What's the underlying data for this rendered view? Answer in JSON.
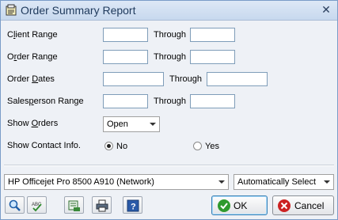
{
  "window": {
    "title": "Order Summary Report"
  },
  "form": {
    "client_range_label_pre": "C",
    "client_range_label_ul": "l",
    "client_range_label_post": "ient Range",
    "order_range_label_pre": "O",
    "order_range_label_ul": "r",
    "order_range_label_post": "der Range",
    "order_dates_label_pre": "Order ",
    "order_dates_label_ul": "D",
    "order_dates_label_post": "ates",
    "salesperson_label_pre": "Sales",
    "salesperson_label_ul": "p",
    "salesperson_label_post": "erson Range",
    "show_orders_label_pre": "Show ",
    "show_orders_label_ul": "O",
    "show_orders_label_post": "rders",
    "show_contact_label": "Show Contact Info.",
    "through_label": "Through",
    "show_orders_value": "Open",
    "contact_no_label": "No",
    "contact_yes_label": "Yes",
    "contact_selected": "No"
  },
  "bottom": {
    "printer_value": "HP Officejet Pro 8500 A910 (Network)",
    "tray_value": "Automatically Select",
    "ok_label": "OK",
    "cancel_label": "Cancel"
  },
  "colors": {
    "title_text": "#1e395b",
    "ok_green": "#2e9a2e",
    "cancel_red": "#cc2222"
  }
}
